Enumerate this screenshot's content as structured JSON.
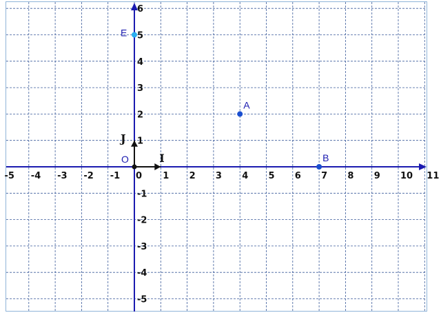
{
  "figure": {
    "x_range": [
      -5,
      11
    ],
    "y_range": [
      -5,
      6
    ],
    "grid": true,
    "x_ticks": [
      "-5",
      "-4",
      "-3",
      "-2",
      "-1",
      "0",
      "1",
      "2",
      "3",
      "4",
      "5",
      "6",
      "7",
      "8",
      "9",
      "10",
      "11"
    ],
    "y_ticks": [
      "-5",
      "-4",
      "-3",
      "-2",
      "-1",
      "1",
      "2",
      "3",
      "4",
      "5",
      "6"
    ],
    "origin_label": "O",
    "unit_vectors": [
      {
        "name": "I",
        "dx": 1,
        "dy": 0
      },
      {
        "name": "J",
        "dx": 0,
        "dy": 1
      }
    ],
    "points": [
      {
        "name": "A",
        "x": 4,
        "y": 2,
        "color": "#1a4fd0"
      },
      {
        "name": "B",
        "x": 7,
        "y": 0,
        "color": "#1a4fd0"
      },
      {
        "name": "E",
        "x": 0,
        "y": 5,
        "color": "#2aaef0"
      }
    ],
    "axis_color": "#1a1ab0",
    "grid_color": "#3a5a9a"
  }
}
